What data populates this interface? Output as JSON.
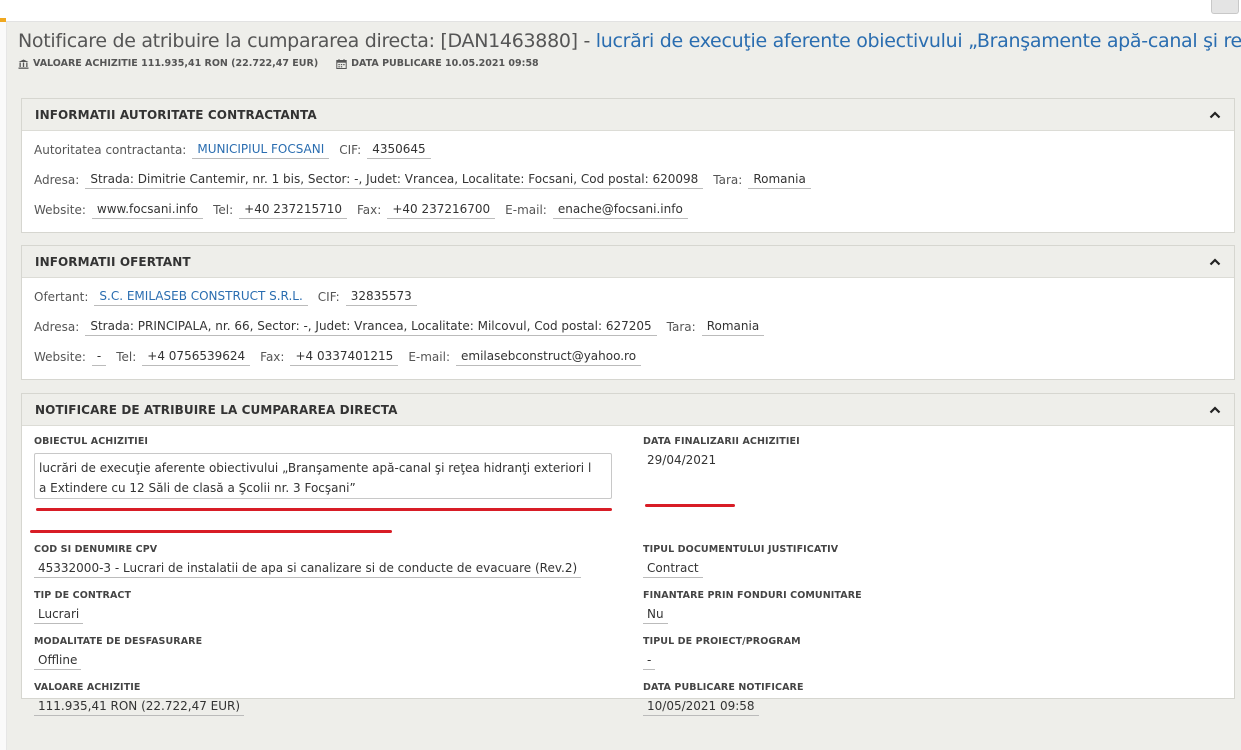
{
  "page": {
    "title_main": "Notificare de atribuire la cumpararea directa: [DAN1463880] - ",
    "title_sub": "lucrări de execuţie aferente obiectivului „Branşamente apă-canal şi reţea ...",
    "valoare_label": "VALOARE ACHIZITIE 111.935,41 RON (22.722,47 EUR)",
    "data_label": "DATA PUBLICARE 10.05.2021 09:58"
  },
  "autoritate": {
    "section_title": "INFORMATII AUTORITATE CONTRACTANTA",
    "autoritate_label": "Autoritatea contractanta:",
    "autoritate_value": "MUNICIPIUL FOCSANI",
    "cif_label": "CIF:",
    "cif_value": "4350645",
    "adresa_label": "Adresa:",
    "adresa_value": "Strada: Dimitrie Cantemir, nr. 1 bis, Sector: -, Judet: Vrancea, Localitate: Focsani, Cod postal: 620098",
    "tara_label": "Tara:",
    "tara_value": "Romania",
    "website_label": "Website:",
    "website_value": "www.focsani.info",
    "tel_label": "Tel:",
    "tel_value": "+40 237215710",
    "fax_label": "Fax:",
    "fax_value": "+40 237216700",
    "email_label": "E-mail:",
    "email_value": "enache@focsani.info"
  },
  "ofertant": {
    "section_title": "INFORMATII OFERTANT",
    "ofertant_label": "Ofertant:",
    "ofertant_value": "S.C. EMILASEB CONSTRUCT S.R.L.",
    "cif_label": "CIF:",
    "cif_value": "32835573",
    "adresa_label": "Adresa:",
    "adresa_value": "Strada: PRINCIPALA, nr. 66, Sector: -, Judet: Vrancea, Localitate: Milcovul, Cod postal: 627205",
    "tara_label": "Tara:",
    "tara_value": "Romania",
    "website_label": "Website:",
    "website_value": "-",
    "tel_label": "Tel:",
    "tel_value": "+4 0756539624",
    "fax_label": "Fax:",
    "fax_value": "+4 0337401215",
    "email_label": "E-mail:",
    "email_value": "emilasebconstruct@yahoo.ro"
  },
  "notificare": {
    "section_title": "NOTIFICARE DE ATRIBUIRE LA CUMPARAREA DIRECTA",
    "obiectul_label": "OBIECTUL ACHIZITIEI",
    "obiectul_line1": "lucrări de execuţie aferente obiectivului „Branşamente apă-canal şi reţea hidranţi exteriori l",
    "obiectul_line2": "a Extindere cu 12 Săli de clasă a Şcolii nr. 3 Focşani”",
    "cpv_label": "COD SI DENUMIRE CPV",
    "cpv_value": "45332000-3 - Lucrari de instalatii de apa si canalizare si de conducte de evacuare (Rev.2)",
    "tip_contract_label": "TIP DE CONTRACT",
    "tip_contract_value": "Lucrari",
    "modalitate_label": "MODALITATE DE DESFASURARE",
    "modalitate_value": "Offline",
    "valoare_label": "VALOARE ACHIZITIE",
    "valoare_value": "111.935,41 RON (22.722,47 EUR)",
    "data_finalizarii_label": "DATA FINALIZARII ACHIZITIEI",
    "data_finalizarii_value": "29/04/2021",
    "tipul_document_label": "TIPUL DOCUMENTULUI JUSTIFICATIV",
    "tipul_document_value": "Contract",
    "finantare_label": "FINANTARE PRIN FONDURI COMUNITARE",
    "finantare_value": "Nu",
    "tipul_proiect_label": "TIPUL DE PROIECT/PROGRAM",
    "tipul_proiect_value": "-",
    "data_publicare_label": "DATA PUBLICARE NOTIFICARE",
    "data_publicare_value": "10/05/2021 09:58"
  },
  "colors": {
    "link": "#2a6db0",
    "annotation": "#d81d26",
    "panel_header": "#eeeeea"
  },
  "icons": {
    "valoare": "bank-icon",
    "data": "calendar-icon",
    "collapse": "chevron-up-icon"
  }
}
